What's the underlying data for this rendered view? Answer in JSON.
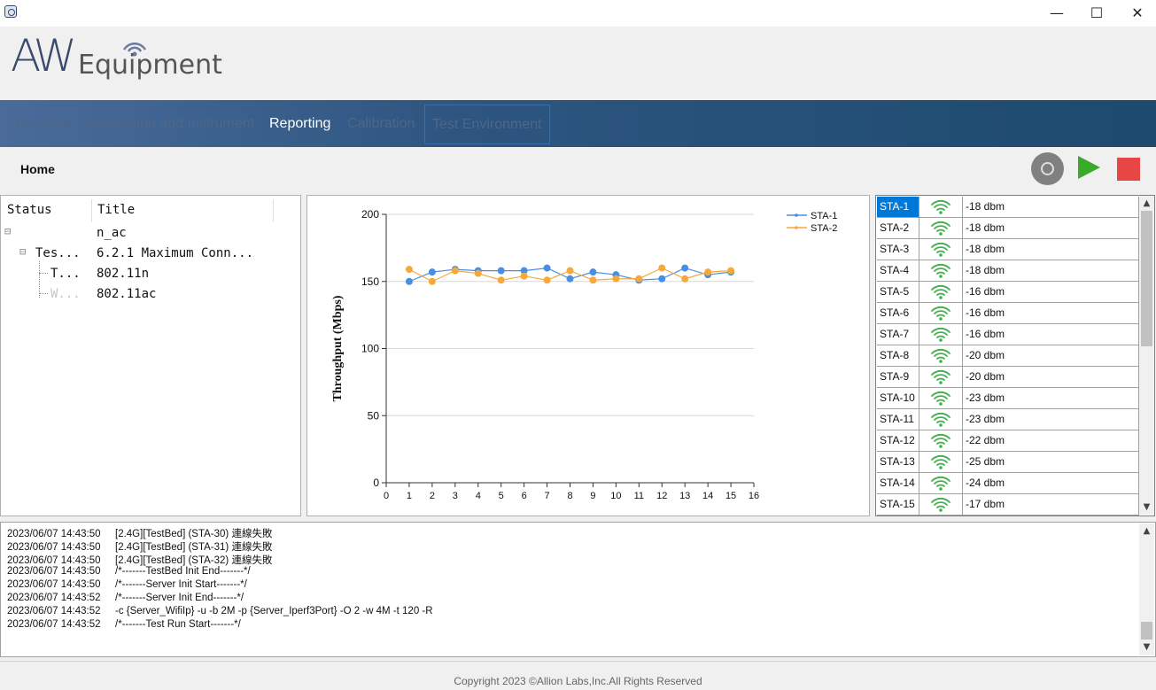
{
  "window": {
    "minimize_glyph": "—",
    "maximize_glyph": "☐",
    "close_glyph": "✕"
  },
  "logo": {
    "aw": "AW",
    "equipment": "Equipment"
  },
  "nav": {
    "items": [
      "Test Item",
      "Attenuation and Instrument",
      "Reporting",
      "Calibration",
      "Test Environment"
    ],
    "active": "Reporting"
  },
  "breadcrumb": {
    "home": "Home"
  },
  "toolbar": {
    "icons": [
      "settings-icon",
      "play-icon",
      "stop-icon"
    ],
    "colors": {
      "play": "#3aaa2a",
      "stop": "#e84545",
      "settings": "#808080"
    }
  },
  "tree": {
    "headers": [
      "Status",
      "Title"
    ],
    "rows": [
      {
        "status": "",
        "title": "n_ac"
      },
      {
        "status": "Tes...",
        "title": "6.2.1 Maximum Conn..."
      },
      {
        "status": "T...",
        "title": "802.11n"
      },
      {
        "status": "W...",
        "title": "802.11ac"
      }
    ],
    "expander": "⊟"
  },
  "chart_data": {
    "type": "line",
    "ylabel": "Throughput (Mbps)",
    "xlabel": "",
    "xlim": [
      0,
      16
    ],
    "ylim": [
      0,
      200
    ],
    "x_ticks": [
      0,
      1,
      2,
      3,
      4,
      5,
      6,
      7,
      8,
      9,
      10,
      11,
      12,
      13,
      14,
      15,
      16
    ],
    "y_ticks": [
      0,
      50,
      100,
      150,
      200
    ],
    "x": [
      1,
      2,
      3,
      4,
      5,
      6,
      7,
      8,
      9,
      10,
      11,
      12,
      13,
      14,
      15
    ],
    "series": [
      {
        "name": "STA-1",
        "color": "#4a8ee0",
        "values": [
          150,
          157,
          159,
          158,
          158,
          158,
          160,
          152,
          157,
          155,
          151,
          152,
          160,
          155,
          157
        ]
      },
      {
        "name": "STA-2",
        "color": "#f5a93c",
        "values": [
          159,
          150,
          158,
          156,
          151,
          154,
          151,
          158,
          151,
          152,
          152,
          160,
          152,
          157,
          158
        ]
      }
    ],
    "grid": "horizontal",
    "legend": "top-right"
  },
  "stations": [
    {
      "name": "STA-1",
      "signal": "-18 dbm"
    },
    {
      "name": "STA-2",
      "signal": "-18 dbm"
    },
    {
      "name": "STA-3",
      "signal": "-18 dbm"
    },
    {
      "name": "STA-4",
      "signal": "-18 dbm"
    },
    {
      "name": "STA-5",
      "signal": "-16 dbm"
    },
    {
      "name": "STA-6",
      "signal": "-16 dbm"
    },
    {
      "name": "STA-7",
      "signal": "-16 dbm"
    },
    {
      "name": "STA-8",
      "signal": "-20 dbm"
    },
    {
      "name": "STA-9",
      "signal": "-20 dbm"
    },
    {
      "name": "STA-10",
      "signal": "-23 dbm"
    },
    {
      "name": "STA-11",
      "signal": "-23 dbm"
    },
    {
      "name": "STA-12",
      "signal": "-22 dbm"
    },
    {
      "name": "STA-13",
      "signal": "-25 dbm"
    },
    {
      "name": "STA-14",
      "signal": "-24 dbm"
    },
    {
      "name": "STA-15",
      "signal": "-17 dbm"
    }
  ],
  "station_selected": "STA-1",
  "wifi_color": "#3cb04a",
  "scroll_up": "▲",
  "scroll_down": "▼",
  "log": [
    {
      "ts": "2023/06/07 14:43:50",
      "msg": "[2.4G][TestBed] (STA-30) 連線失敗"
    },
    {
      "ts": "2023/06/07 14:43:50",
      "msg": "[2.4G][TestBed] (STA-31) 連線失敗"
    },
    {
      "ts": "2023/06/07 14:43:50",
      "msg": "[2.4G][TestBed] (STA-32) 連線失敗"
    },
    {
      "ts": "2023/06/07 14:43:50",
      "msg": "/*-------TestBed Init End-------*/"
    },
    {
      "ts": "2023/06/07 14:43:50",
      "msg": "/*-------Server Init Start-------*/"
    },
    {
      "ts": "2023/06/07 14:43:52",
      "msg": "/*-------Server Init End-------*/"
    },
    {
      "ts": "2023/06/07 14:43:52",
      "msg": "-c {Server_WifiIp} -u -b 2M -p {Server_Iperf3Port} -O 2 -w 4M -t 120 -R"
    },
    {
      "ts": "2023/06/07 14:43:52",
      "msg": "/*-------Test Run Start-------*/"
    }
  ],
  "footer": {
    "copyright": "Copyright 2023 ©Allion Labs,Inc.All Rights Reserved"
  }
}
